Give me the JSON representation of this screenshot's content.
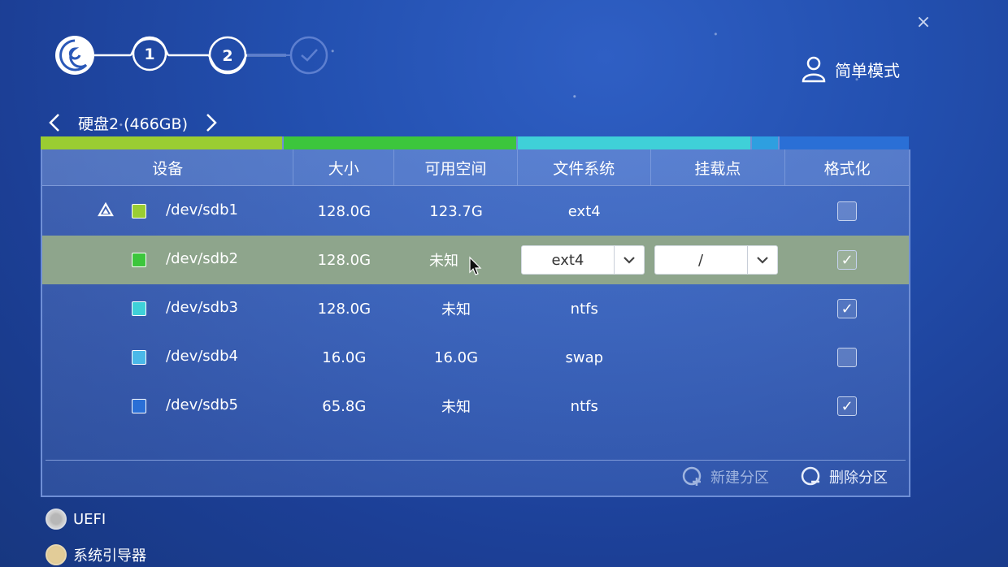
{
  "window": {
    "close_label": "×"
  },
  "steps": {
    "labels": [
      "1",
      "2"
    ]
  },
  "header": {
    "mode_label": "简单模式"
  },
  "disk": {
    "label": "硬盘2 (466GB)"
  },
  "usage_bar": {
    "segments": [
      {
        "color": "#9acd32",
        "flex": 0.28
      },
      {
        "color": "#3cc63c",
        "flex": 0.27
      },
      {
        "color": "#3fd0d8",
        "flex": 0.27
      },
      {
        "color": "#2e9fe0",
        "flex": 0.03
      },
      {
        "color": "#2a6fd6",
        "flex": 0.15
      }
    ]
  },
  "table": {
    "columns": [
      "设备",
      "大小",
      "可用空间",
      "文件系统",
      "挂载点",
      "格式化"
    ],
    "rows": [
      {
        "device": "/dev/sdb1",
        "size": "128.0G",
        "free": "123.7G",
        "fs": "ext4",
        "mount": "",
        "format": false,
        "color": "#9acd32",
        "boot": true
      },
      {
        "device": "/dev/sdb2",
        "size": "128.0G",
        "free": "未知",
        "fs": "ext4",
        "mount": "/",
        "format": true,
        "color": "#3cc63c",
        "selected": true
      },
      {
        "device": "/dev/sdb3",
        "size": "128.0G",
        "free": "未知",
        "fs": "ntfs",
        "mount": "",
        "format": true,
        "color": "#3fd0d8"
      },
      {
        "device": "/dev/sdb4",
        "size": "16.0G",
        "free": "16.0G",
        "fs": "swap",
        "mount": "",
        "format": false,
        "color": "#4ab8e8"
      },
      {
        "device": "/dev/sdb5",
        "size": "65.8G",
        "free": "未知",
        "fs": "ntfs",
        "mount": "",
        "format": true,
        "color": "#2a6fd6"
      }
    ]
  },
  "actions": {
    "new_partition": "新建分区",
    "delete_partition": "删除分区"
  },
  "options": {
    "uefi": "UEFI",
    "bootloader": "系统引导器"
  }
}
